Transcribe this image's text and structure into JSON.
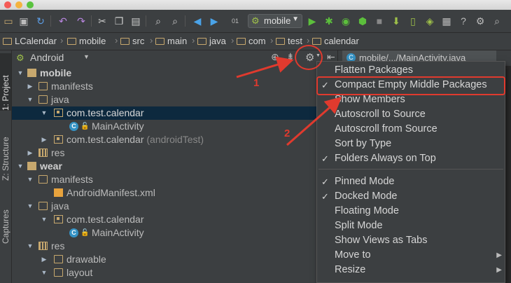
{
  "titlebar": {
    "traffic_lights": {
      "close": "#f45b56",
      "min": "#f4b33f",
      "max": "#5ac33f"
    }
  },
  "toolbar": {
    "icons": [
      "folder-open-icon",
      "save-icon",
      "sync-icon",
      "undo-icon",
      "redo-icon",
      "cut-icon",
      "copy-icon",
      "paste-icon",
      "find-icon",
      "replace-icon",
      "back-icon",
      "forward-icon",
      "make-icon",
      "run-config-icon",
      "run-icon",
      "debug-icon",
      "profile-icon",
      "attach-icon",
      "stop-icon",
      "sdk-icon"
    ],
    "run_config": "mobile"
  },
  "breadcrumb": {
    "items": [
      "LCalendar",
      "mobile",
      "src",
      "main",
      "java",
      "com",
      "test",
      "calendar"
    ]
  },
  "left_stripe": {
    "tabs": [
      "1: Project",
      "Z: Structure",
      "Captures"
    ]
  },
  "project_panel": {
    "view_selector": "Android",
    "tree": [
      {
        "label": "mobile",
        "type": "module",
        "bold": true
      },
      {
        "label": "manifests",
        "type": "dir"
      },
      {
        "label": "java",
        "type": "dir"
      },
      {
        "label": "com.test.calendar",
        "type": "pkg"
      },
      {
        "label": "MainActivity",
        "type": "class"
      },
      {
        "label": "com.test.calendar",
        "suffix": "(androidTest)",
        "type": "pkg"
      },
      {
        "label": "res",
        "type": "res"
      },
      {
        "label": "wear",
        "type": "module",
        "bold": true
      },
      {
        "label": "manifests",
        "type": "dir"
      },
      {
        "label": "AndroidManifest.xml",
        "type": "xml"
      },
      {
        "label": "java",
        "type": "dir"
      },
      {
        "label": "com.test.calendar",
        "type": "pkg"
      },
      {
        "label": "MainActivity",
        "type": "class"
      },
      {
        "label": "res",
        "type": "res"
      },
      {
        "label": "drawable",
        "type": "dir"
      },
      {
        "label": "layout",
        "type": "dir"
      }
    ]
  },
  "editor": {
    "tab_label": "mobile/.../MainActivity.java"
  },
  "gear_menu": {
    "items": [
      {
        "label": "Flatten Packages",
        "checked": false
      },
      {
        "label": "Compact Empty Middle Packages",
        "checked": true
      },
      {
        "label": "Show Members",
        "checked": false
      },
      {
        "label": "Autoscroll to Source",
        "checked": false
      },
      {
        "label": "Autoscroll from Source",
        "checked": false
      },
      {
        "label": "Sort by Type",
        "checked": false
      },
      {
        "label": "Folders Always on Top",
        "checked": true
      },
      {
        "label": "Pinned Mode",
        "checked": true
      },
      {
        "label": "Docked Mode",
        "checked": true
      },
      {
        "label": "Floating Mode",
        "checked": false
      },
      {
        "label": "Split Mode",
        "checked": false
      },
      {
        "label": "Show Views as Tabs",
        "checked": false
      },
      {
        "label": "Move to",
        "checked": false,
        "submenu": true
      },
      {
        "label": "Resize",
        "checked": false,
        "submenu": true
      }
    ]
  },
  "annotations": {
    "step1": "1",
    "step2": "2",
    "color": "#e03a2e"
  },
  "colors": {
    "accent": "#e03a2e",
    "selection": "#0d293e",
    "panel": "#3c3f41",
    "editor": "#2b2b2b"
  }
}
